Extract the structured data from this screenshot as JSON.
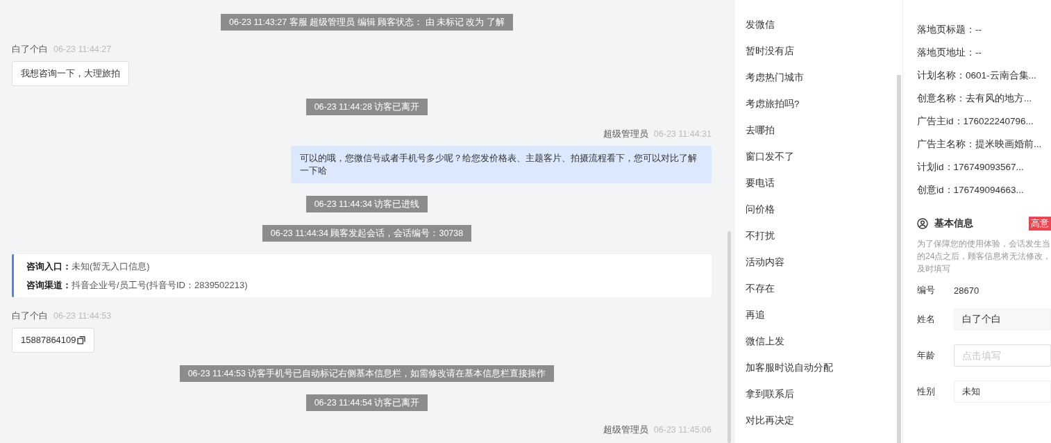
{
  "chat": {
    "messages": [
      {
        "kind": "system",
        "text": "06-23 11:43:27 客服 超级管理员 编辑 顾客状态： 由 未标记 改为 了解"
      },
      {
        "kind": "visitor",
        "name": "白了个白",
        "time": "06-23 11:44:27",
        "text": "我想咨询一下，大理旅拍"
      },
      {
        "kind": "system",
        "text": "06-23 11:44:28 访客已离开"
      },
      {
        "kind": "agent",
        "name": "超级管理员",
        "time": "06-23 11:44:31",
        "text": "可以的哦，您微信号或者手机号多少呢？给您发价格表、主题客片、拍摄流程看下，您可以对比了解一下哈"
      },
      {
        "kind": "system",
        "text": "06-23 11:44:34 访客已进线"
      },
      {
        "kind": "system",
        "text": "06-23 11:44:34 顾客发起会话，会话编号：30738"
      },
      {
        "kind": "info",
        "lines": [
          {
            "label": "咨询入口：",
            "value": "未知(暂无入口信息)"
          },
          {
            "label": "咨询渠道：",
            "value": "抖音企业号/员工号(抖音号ID：2839502213)"
          }
        ]
      },
      {
        "kind": "visitor",
        "name": "白了个白",
        "time": "06-23 11:44:53",
        "text": "15887864109",
        "copyable": true
      },
      {
        "kind": "system",
        "text": "06-23 11:44:53 访客手机号已自动标记右侧基本信息栏，如需修改请在基本信息栏直接操作"
      },
      {
        "kind": "system",
        "text": "06-23 11:44:54 访客已离开"
      },
      {
        "kind": "agent",
        "name": "超级管理员",
        "time": "06-23 11:45:06"
      }
    ]
  },
  "quick_replies": [
    "发微信",
    "暂时没有店",
    "考虑热门城市",
    "考虑旅拍吗?",
    "去哪拍",
    "窗口发不了",
    "要电话",
    "问价格",
    "不打扰",
    "活动内容",
    "不存在",
    "再追",
    "微信上发",
    "加客服时说自动分配",
    "拿到联系后",
    "对比再决定"
  ],
  "details": {
    "rows": [
      "落地页标题：--",
      "落地页地址：--",
      "计划名称：0601-云南合集...",
      "创意名称：去有风的地方...",
      "广告主id：176022240796...",
      "广告主名称：提米映画婚前...",
      "计划id：176749093567...",
      "创意id：176749094663..."
    ],
    "basic_info": {
      "title": "基本信息",
      "badge": "高意",
      "notice": [
        "为了保障您的使用体验，会话发生当",
        "的24点之后，顾客信息将无法修改，",
        "及时填写"
      ],
      "fields": [
        {
          "kind": "text",
          "label": "编号",
          "value": "28670"
        },
        {
          "kind": "input",
          "label": "姓名",
          "value": "白了个白"
        },
        {
          "kind": "input",
          "label": "年龄",
          "placeholder": "点击填写"
        },
        {
          "kind": "select",
          "label": "性别",
          "value": "未知"
        }
      ]
    }
  }
}
